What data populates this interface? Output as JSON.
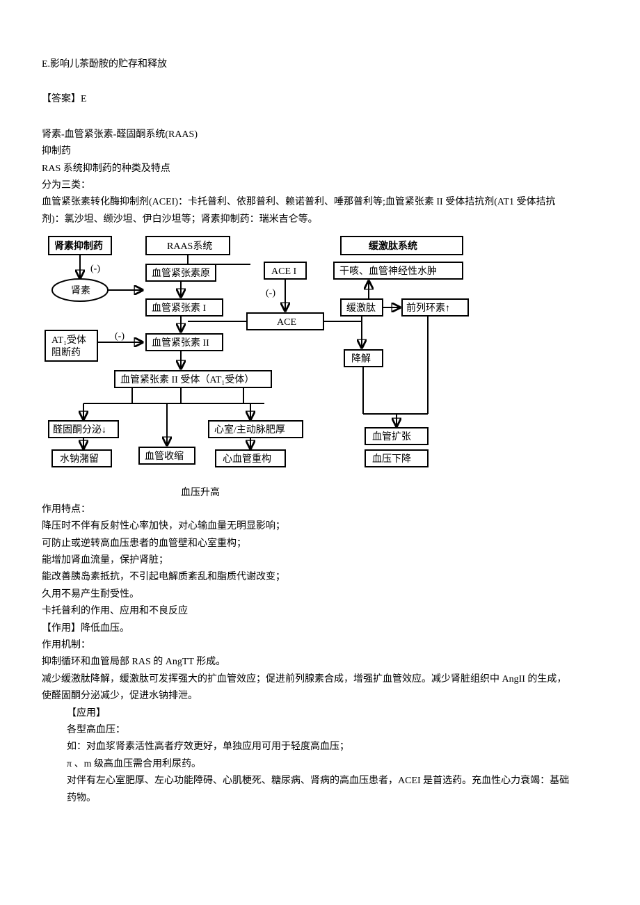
{
  "lines": {
    "optionE": "E.影响儿茶酚胺的贮存和释放",
    "answer": "【答案】E",
    "raas": "肾素-血管紧张素-醛固酮系统(RAAS)",
    "inhibitor": "抑制药",
    "rasTypes": "RAS 系统抑制药的种类及特点",
    "threeCategories": "分为三类：",
    "acei1": "血管紧张素转化酶抑制剂(ACEI)：卡托普利、依那普利、赖诺普利、唾那普利等;血管紧张素 II 受体拮抗剂(AT1 受体拮抗",
    "acei2": "剂)：氯沙坦、缬沙坦、伊白沙坦等；肾素抑制药：瑞米吉仑等。",
    "diagCaption": "血压升高",
    "feat": "作用特点：",
    "feat1": "降压时不伴有反射性心率加快，对心输血量无明显影响；",
    "feat2": "可防止或逆转高血压患者的血管壁和心室重构；",
    "feat3": "能增加肾血流量，保护肾脏；",
    "feat4": "能改善胰岛素抵抗，不引起电解质紊乱和脂质代谢改变；",
    "feat5": "久用不易产生耐受性。",
    "capto": "卡托普利的作用、应用和不良反应",
    "action": "【作用】降低血压。",
    "mech": "作用机制：",
    "mech1": "抑制循环和血管局部 RAS 的 AngTT 形成。",
    "mech2": "减少缓激肽降解，缓激肽可发挥强大的扩血管效应；促进前列腺素合成，增强扩血管效应。减少肾脏组织中 AngII 的生成，",
    "mech3": "使醛固酮分泌减少，促进水钠排泄。",
    "app": "【应用】",
    "app1": "各型高血压：",
    "app2": "如：对血浆肾素活性高者疗效更好，单独应用可用于轻度高血压；",
    "app3": "π 、m 级高血压需合用利尿药。",
    "app4": "对伴有左心室肥厚、左心功能障碍、心肌梗死、糖尿病、肾病的高血压患者，ACEI 是首选药。充血性心力衰竭：基础",
    "app5": "药物。"
  },
  "diagram": {
    "top": {
      "reninDrug": "肾素抑制药",
      "raas": "RAAS系统",
      "kinin": "缓激肽系统"
    },
    "nodes": {
      "renin": "肾素",
      "angiotensinogen": "血管紧张素原",
      "angI": "血管紧张素 I",
      "angII": "血管紧张素 II",
      "at1rec": "血管紧张素 II 受体（AT₁受体）",
      "at1block1": "AT₁受体",
      "at1block2": "阻断药",
      "aceI": "ACE I",
      "ace": "ACE",
      "cough": "干咳、血管神经性水肿",
      "bradykinin": "缓激肽",
      "prostacyclin": "前列环素↑",
      "degradation": "降解",
      "aldosterone": "醛固酮分泌↓",
      "water": "水钠潴留",
      "vasoconstrict": "血管收缩",
      "hypertrophy": "心室/主动脉肥厚",
      "remodel": "心血管重构",
      "dilation": "血管扩张",
      "bpdown": "血压下降"
    },
    "neg": "(-)"
  }
}
